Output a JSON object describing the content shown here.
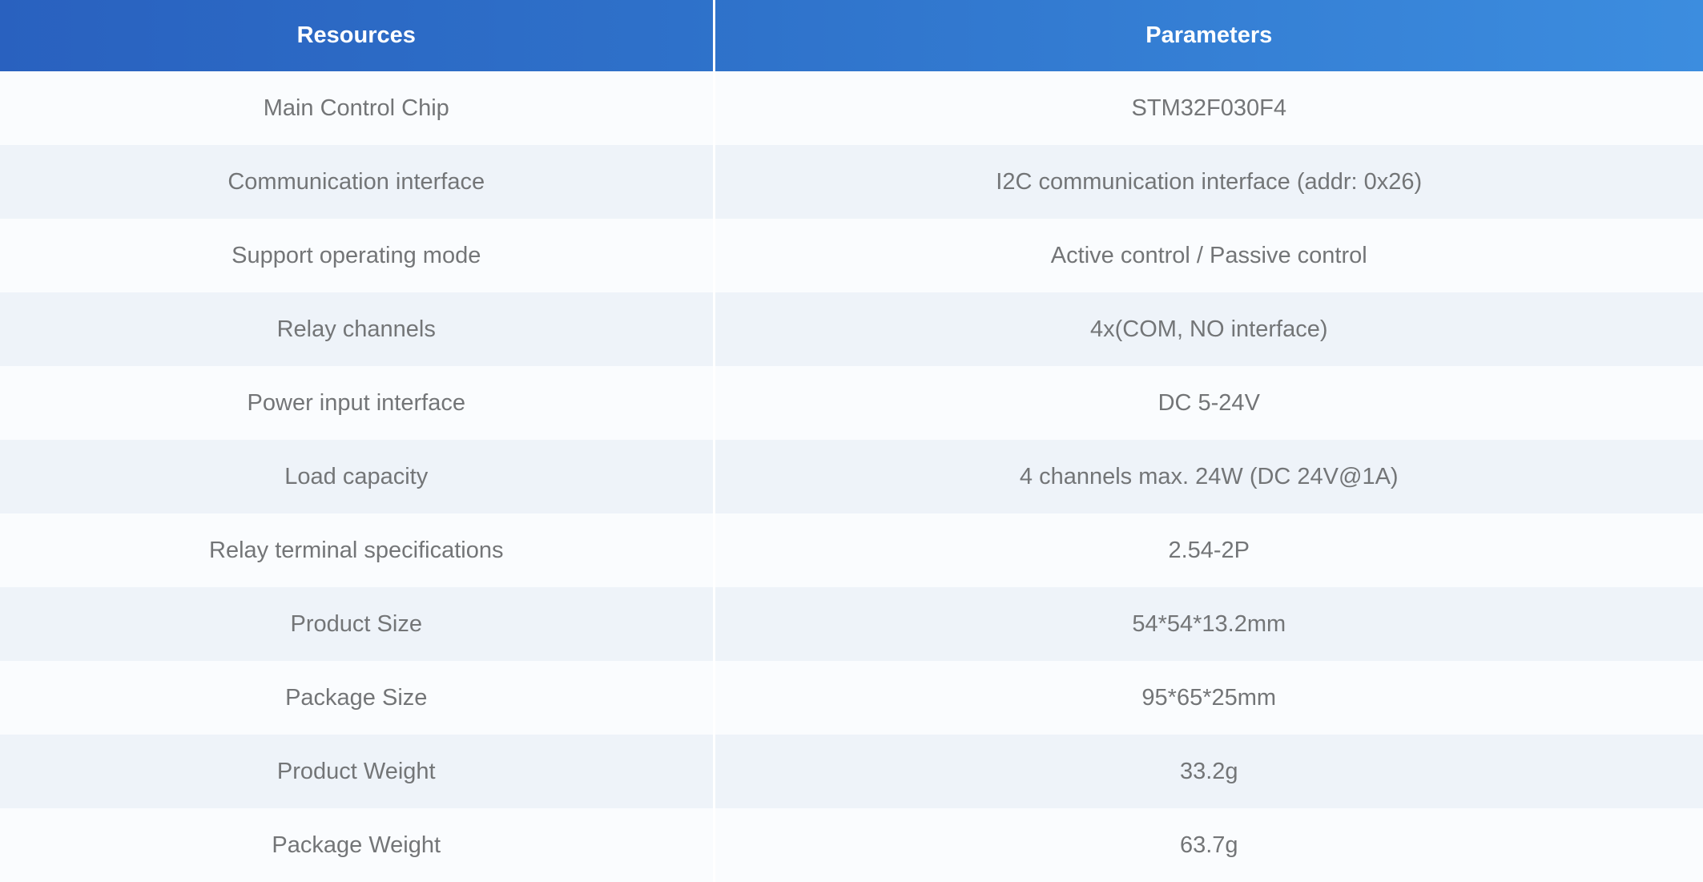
{
  "table": {
    "headers": {
      "resources": "Resources",
      "parameters": "Parameters"
    },
    "rows": [
      {
        "resource": "Main Control Chip",
        "parameter": "STM32F030F4"
      },
      {
        "resource": "Communication interface",
        "parameter": "I2C communication interface (addr: 0x26)"
      },
      {
        "resource": "Support operating mode",
        "parameter": "Active control / Passive control"
      },
      {
        "resource": "Relay channels",
        "parameter": "4x(COM, NO interface)"
      },
      {
        "resource": "Power input interface",
        "parameter": "DC 5-24V"
      },
      {
        "resource": "Load capacity",
        "parameter": "4 channels max. 24W (DC 24V@1A)"
      },
      {
        "resource": "Relay terminal specifications",
        "parameter": "2.54-2P"
      },
      {
        "resource": "Product Size",
        "parameter": "54*54*13.2mm"
      },
      {
        "resource": "Package Size",
        "parameter": "95*65*25mm"
      },
      {
        "resource": "Product Weight",
        "parameter": "33.2g"
      },
      {
        "resource": "Package Weight",
        "parameter": "63.7g"
      }
    ]
  },
  "colors": {
    "header_gradient_start": "#2961bf",
    "header_gradient_end": "#3c8ddf",
    "header_text": "#ffffff",
    "row_light": "#fafcfe",
    "row_alt": "#eef3f9",
    "cell_text": "#737577"
  }
}
